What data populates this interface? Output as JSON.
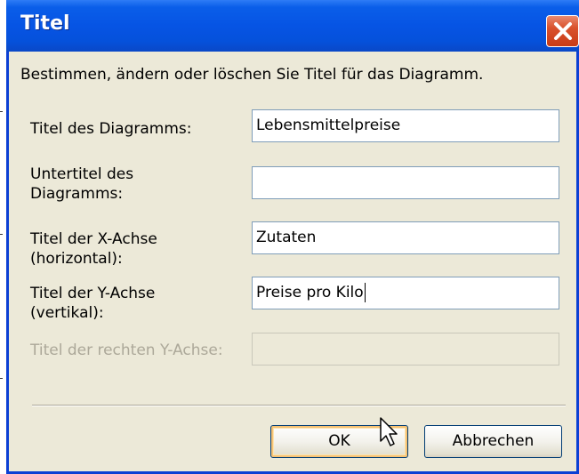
{
  "window": {
    "title": "Titel"
  },
  "dialog": {
    "intro": "Bestimmen, ändern oder löschen Sie Titel für das Diagramm.",
    "fields": [
      {
        "label": "Titel des Diagramms:",
        "value": "Lebensmittelpreise",
        "enabled": true
      },
      {
        "label": "Untertitel des Diagramms:",
        "value": "",
        "enabled": true
      },
      {
        "label": "Titel der X-Achse (horizontal):",
        "value": "Zutaten",
        "enabled": true
      },
      {
        "label": "Titel der Y-Achse (vertikal):",
        "value": "Preise pro Kilo",
        "enabled": true
      },
      {
        "label": "Titel der rechten Y-Achse:",
        "value": "",
        "enabled": false
      }
    ],
    "buttons": {
      "ok": "OK",
      "cancel": "Abbrechen"
    }
  },
  "colors": {
    "titlebar": "#0654e4",
    "client_bg": "#ece9d8",
    "close_button": "#d9512c",
    "disabled_text": "#aca899"
  },
  "icons": [
    "close-icon",
    "mouse-pointer-icon"
  ]
}
